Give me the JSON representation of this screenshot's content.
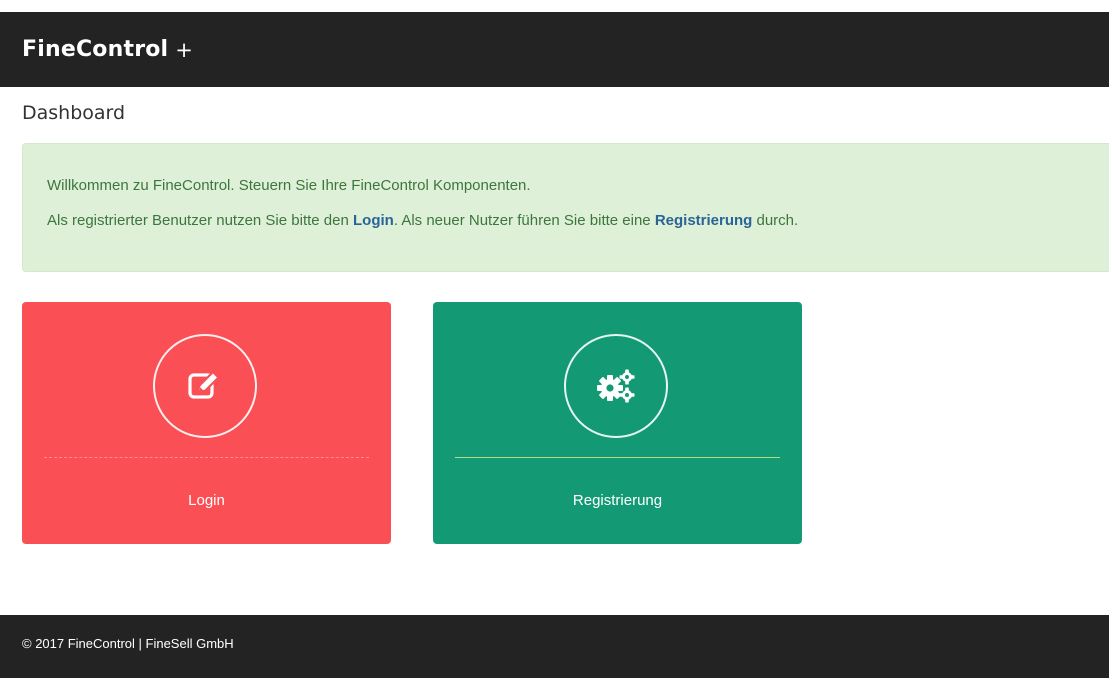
{
  "navbar": {
    "brand": "FineControl",
    "brand_suffix": "+"
  },
  "page": {
    "title": "Dashboard"
  },
  "alert": {
    "line1": "Willkommen zu FineControl. Steuern Sie Ihre FineControl Komponenten.",
    "line2_prefix": "Als registrierter Benutzer nutzen Sie bitte den ",
    "line2_login_link": "Login",
    "line2_middle": ". Als neuer Nutzer führen Sie bitte eine ",
    "line2_register_link": "Registrierung",
    "line2_suffix": " durch."
  },
  "tiles": [
    {
      "label": "Login",
      "icon": "edit-icon",
      "color": "#f94f55"
    },
    {
      "label": "Registrierung",
      "icon": "gears-icon",
      "color": "#139a74"
    }
  ],
  "footer": {
    "text": "© 2017 FineControl | FineSell GmbH"
  },
  "colors": {
    "navbar_bg": "#232323",
    "alert_bg": "#dff0d8",
    "alert_text": "#3c763d",
    "link": "#2a6496"
  }
}
